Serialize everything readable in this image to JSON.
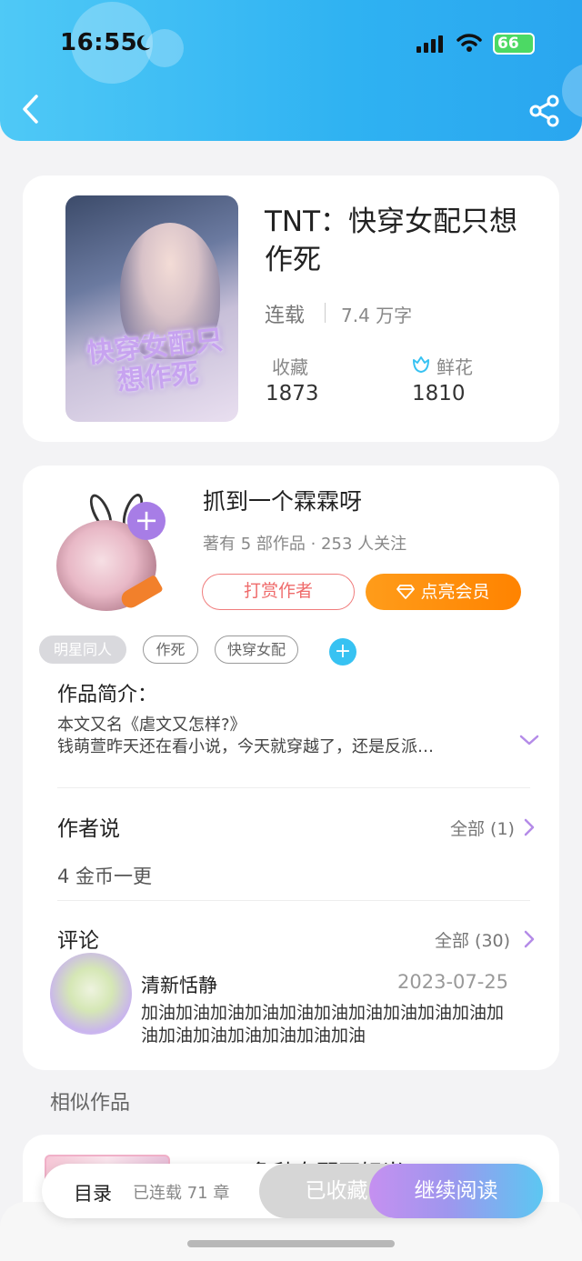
{
  "status_bar": {
    "time": "16:55",
    "battery": "66"
  },
  "book": {
    "title": "TNT：快穿女配只想作死",
    "status": "连载",
    "words": "7.4 万字",
    "favorites_label": "收藏",
    "favorites_count": "1873",
    "flowers_label": "鲜花",
    "flowers_count": "1810",
    "cover_tnt": "/TNT/",
    "cover_title": "快穿女配只想作死"
  },
  "author": {
    "name": "抓到一个霖霖呀",
    "meta": "著有 5 部作品 · 253 人关注",
    "tip_label": "打赏作者",
    "vip_label": "点亮会员"
  },
  "tags": [
    "明星同人",
    "作死",
    "快穿女配"
  ],
  "intro": {
    "heading": "作品简介：",
    "line1": "本文又名《虐文又怎样?》",
    "line2": "钱萌萱昨天还在看小说，今天就穿越了，还是反派…"
  },
  "author_says": {
    "heading": "作者说",
    "more": "全部 (1)",
    "content": "4 金币一更"
  },
  "comments": {
    "heading": "评论",
    "more": "全部 (30)",
    "items": [
      {
        "name": "清新恬静",
        "date": "2023-07-25",
        "text": "加油加油加油加油加油加油加油加油加油加油加油加油加油加油加油加油加油"
      }
    ]
  },
  "similar": {
    "heading": "相似作品",
    "first_title": "TNT：鲁秋女配不好当"
  },
  "bottom_bar": {
    "toc_label": "目录",
    "chapters": "已连载 71 章",
    "collected_label": "已收藏",
    "read_label": "继续阅读"
  },
  "colors": {
    "header": "#2fb2f2",
    "accent_purple": "#a77de6",
    "vip_orange": "#ff8c0a",
    "tip_red": "#ef6b6b"
  }
}
